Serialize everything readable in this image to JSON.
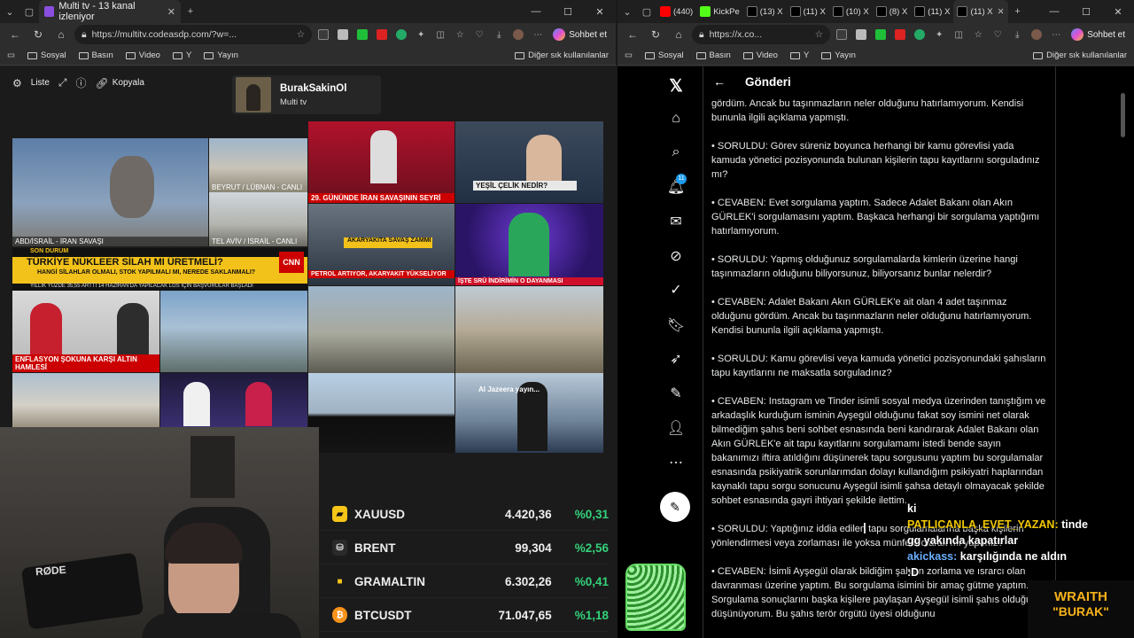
{
  "left_browser": {
    "tabs": [
      {
        "title": "Multi tv - 13 kanal izleniyor"
      }
    ],
    "url": "https://multitv.codeasdp.com/?w=...",
    "chat_label": "Sohbet et",
    "bookmarks": [
      "Sosyal",
      "Basın",
      "Video",
      "Y",
      "Yayın"
    ],
    "other_bookmarks": "Diğer sık kullanılanlar"
  },
  "multitv": {
    "toolbar": {
      "list_label": "Liste",
      "copy_label": "Kopyala"
    },
    "profile": {
      "name": "BurakSakinOl",
      "subtitle": "Multi tv"
    },
    "tiles": {
      "t1_label": "ABD/İSRAİL - İRAN SAVAŞI",
      "t2_label": "BEYRUT / LÜBNAN - CANLI",
      "t3_label": "TEL AVİV / İSRAİL - CANLI",
      "t4_caption": "29. GÜNÜNDE İRAN SAVAŞININ SEYRİ",
      "t5_caption": "YEŞİL ÇELİK NEDİR?",
      "t6_caption": "AKARYAKITA SAVAŞ ZAMMI",
      "t6_sub": "PETROL ARTIYOR, AKARYAKIT YÜKSELİYOR",
      "t7_caption": "İŞTE SRÜ İNDİRİMİN O DAYANMASI",
      "t8_caption": "ENFLASYON ŞOKUNA KARŞI ALTIN HAMLESİ",
      "t9_label": "Al Jazeera yayın...",
      "ticker_head": "SON DURUM",
      "ticker_title": "TÜRKİYE NÜKLEER SİLAH MI ÜRETMELİ?",
      "ticker_sub": "HANGİ SİLAHLAR OLMALI, STOK YAPILMALI MI, NEREDE SAKLANMALI?",
      "ticker_bottom": "YILLIK YÜZDE 35,55 ARTTI    14 HAZİRAN'DA YAPILACAK LGS İÇİN BAŞVURULAR BAŞLADI",
      "cnn_badge": "CNN"
    }
  },
  "market": [
    {
      "symbol": "XAUUSD",
      "value": "4.420,36",
      "change": "%0,31",
      "icon_color": "#f5c518"
    },
    {
      "symbol": "BRENT",
      "value": "99,304",
      "change": "%2,56",
      "icon_color": "#cccccc"
    },
    {
      "symbol": "GRAMALTIN",
      "value": "6.302,26",
      "change": "%0,41",
      "icon_color": "#f5c518"
    },
    {
      "symbol": "BTCUSDT",
      "value": "71.047,65",
      "change": "%1,18",
      "icon_color": "#f7931a"
    }
  ],
  "webcam": {
    "mic_brand": "RØDE"
  },
  "right_browser": {
    "tabs": [
      "(440)",
      "KickPe",
      "(13) X",
      "(11) X",
      "(10) X",
      "(8) X",
      "(11) X",
      "(11) X"
    ],
    "url": "https://x.co...",
    "chat_label": "Sohbet et",
    "bookmarks": [
      "Sosyal",
      "Basın",
      "Video",
      "Y",
      "Yayın"
    ],
    "other_bookmarks": "Diğer sık kullanılanlar"
  },
  "x_page": {
    "header_title": "Gönderi",
    "notif_count": "11",
    "paragraphs": [
      "gördüm. Ancak bu taşınmazların neler olduğunu hatırlamıyorum. Kendisi bununla ilgili açıklama yapmıştı.",
      "• SORULDU: Görev süreniz boyunca herhangi bir kamu görevlisi yada kamuda yönetici pozisyonunda bulunan kişilerin tapu kayıtlarını sorguladınız mı?",
      "• CEVABEN: Evet sorgulama yaptım. Sadece Adalet Bakanı olan Akın GÜRLEK'i sorgulamasını yaptım. Başkaca herhangi bir sorgulama yaptığımı hatırlamıyorum.",
      "• SORULDU: Yapmış olduğunuz sorgulamalarda kimlerin üzerine hangi taşınmazların olduğunu biliyorsunuz, biliyorsanız bunlar nelerdir?",
      "• CEVABEN: Adalet Bakanı Akın GÜRLEK'e ait olan 4 adet taşınmaz olduğunu gördüm. Ancak bu taşınmazların neler olduğunu hatırlamıyorum. Kendisi bununla ilgili açıklama yapmıştı.",
      "• SORULDU: Kamu görevlisi veya kamuda yönetici pozisyonundaki şahısların tapu kayıtlarını ne maksatla sorguladınız?",
      "• CEVABEN: Instagram ve Tinder isimli sosyal medya üzerinden tanıştığım ve arkadaşlık kurduğum isminin Ayşegül olduğunu fakat soy ismini net olarak bilmediğim şahıs beni sohbet esnasında beni kandırarak Adalet Bakanı olan Akın GÜRLEK'e ait tapu kayıtlarını sorgulamamı istedi bende sayın bakanımızı iftira atıldığını düşünerek tapu sorgusunu yaptım bu sorgulamalar esnasında psikiyatrik sorunlarımdan dolayı kullandığım psikiyatri haplarından kaynaklı tapu sorgu sonucunu Ayşegül isimli şahsa detaylı olmayacak şekilde sohbet esnasında gayri ihtiyari şekilde ilettim.",
      "• SORULDU: Yaptığınız iddia edilen tapu sorgulamalarına başka kişilerin yönlendirmesi veya zorlaması ile yoksa münferit olarak mı yaptınız?",
      "• CEVABEN: İsimli Ayşegül olarak bildiğim şahsın zorlama ve ısrarcı olan davranması üzerine yaptım. Bu sorgulama isimini bir amaç gütme yaptım. Sorgulama sonuçlarını başka kişilere paylaşan Ayşegül isimli şahıs olduğunu düşünüyorum. Bu şahıs terör örgütü üyesi olduğunu"
    ]
  },
  "chat": {
    "line0": "ki",
    "user1": "PATLICANLA_EVET_YAZAN:",
    "msg1a": "tinde",
    "msg1b": "gg",
    "msg1c": "yakında kapatırlar",
    "user2": "akickass:",
    "msg2a": "karşılığında ne aldın",
    "msg2b": ":D"
  },
  "wraith": {
    "line1": "WRAITH",
    "line2": "\"BURAK\""
  }
}
